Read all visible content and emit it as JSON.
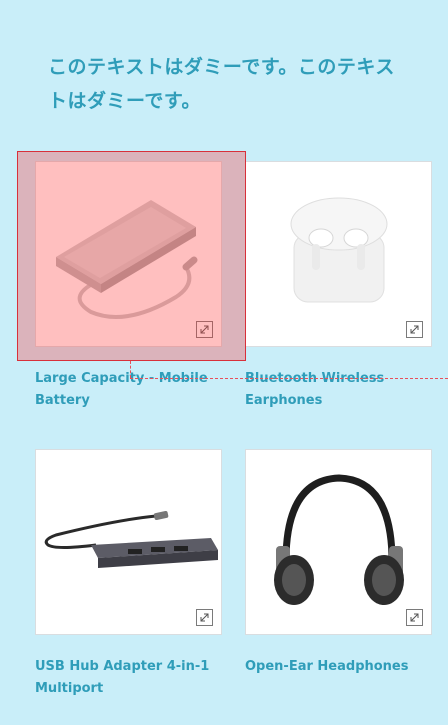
{
  "heading": "このテキストはダミーです。このテキストはダミーです。",
  "products": [
    {
      "title": "Large Capacity - Mobile Battery",
      "image": "power-bank"
    },
    {
      "title": "Bluetooth Wireless Earphones",
      "image": "wireless-earbuds"
    },
    {
      "title": "USB Hub Adapter 4-in-1 Multiport",
      "image": "usb-hub"
    },
    {
      "title": "Open-Ear Headphones",
      "image": "headphones"
    }
  ],
  "icons": {
    "expand": "expand-icon"
  },
  "colors": {
    "background": "#c9eef9",
    "accent_text": "#2f9db9",
    "highlight": "#d8303a"
  }
}
